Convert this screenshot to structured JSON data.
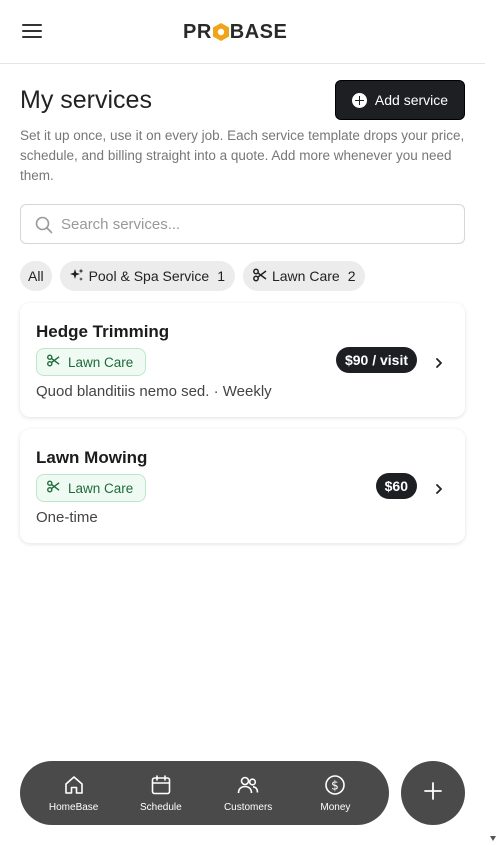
{
  "header": {
    "logo_text_left": "PR",
    "logo_text_right": "BASE"
  },
  "page": {
    "title": "My services",
    "add_button_label": "Add service",
    "description": "Set it up once, use it on every job. Each service template drops your price, schedule, and billing straight into a quote. Add more whenever you need them."
  },
  "search": {
    "placeholder": "Search services..."
  },
  "filters": [
    {
      "label": "All"
    },
    {
      "label": "Pool & Spa Service",
      "count": "1",
      "icon": "sparkles-icon"
    },
    {
      "label": "Lawn Care",
      "count": "2",
      "icon": "scissors-icon"
    }
  ],
  "services": [
    {
      "name": "Hedge Trimming",
      "category": "Lawn Care",
      "meta": "Quod blanditiis nemo sed. · Weekly",
      "price": "$90 / visit"
    },
    {
      "name": "Lawn Mowing",
      "category": "Lawn Care",
      "meta": "One-time",
      "price": "$60"
    }
  ],
  "bottom_nav": [
    {
      "label": "HomeBase",
      "icon": "home-icon"
    },
    {
      "label": "Schedule",
      "icon": "calendar-icon"
    },
    {
      "label": "Customers",
      "icon": "users-icon"
    },
    {
      "label": "Money",
      "icon": "dollar-icon"
    }
  ],
  "colors": {
    "dark": "#1d1f22",
    "tag_green": "#1e6b3a",
    "tag_bg": "#effbf2",
    "logo_accent": "#f0a418",
    "nav_bg": "#4a4a4a"
  }
}
